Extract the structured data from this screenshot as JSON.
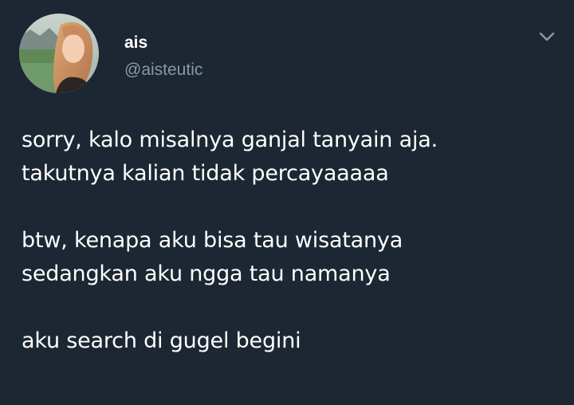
{
  "tweet": {
    "author": {
      "display_name": "ais",
      "handle": "@aisteutic",
      "avatar_icon": "profile-photo"
    },
    "menu_icon": "chevron-down-icon",
    "text_paragraphs": [
      [
        "sorry, kalo misalnya ganjal tanyain aja.",
        "takutnya kalian tidak percayaaaaa"
      ],
      [
        "btw, kenapa aku bisa tau wisatanya",
        "sedangkan aku ngga tau namanya"
      ],
      [
        "aku search di gugel begini"
      ]
    ]
  },
  "colors": {
    "background": "#1c2733",
    "primary_text": "#ffffff",
    "secondary_text": "#8899a6",
    "chevron": "#8899a6"
  }
}
